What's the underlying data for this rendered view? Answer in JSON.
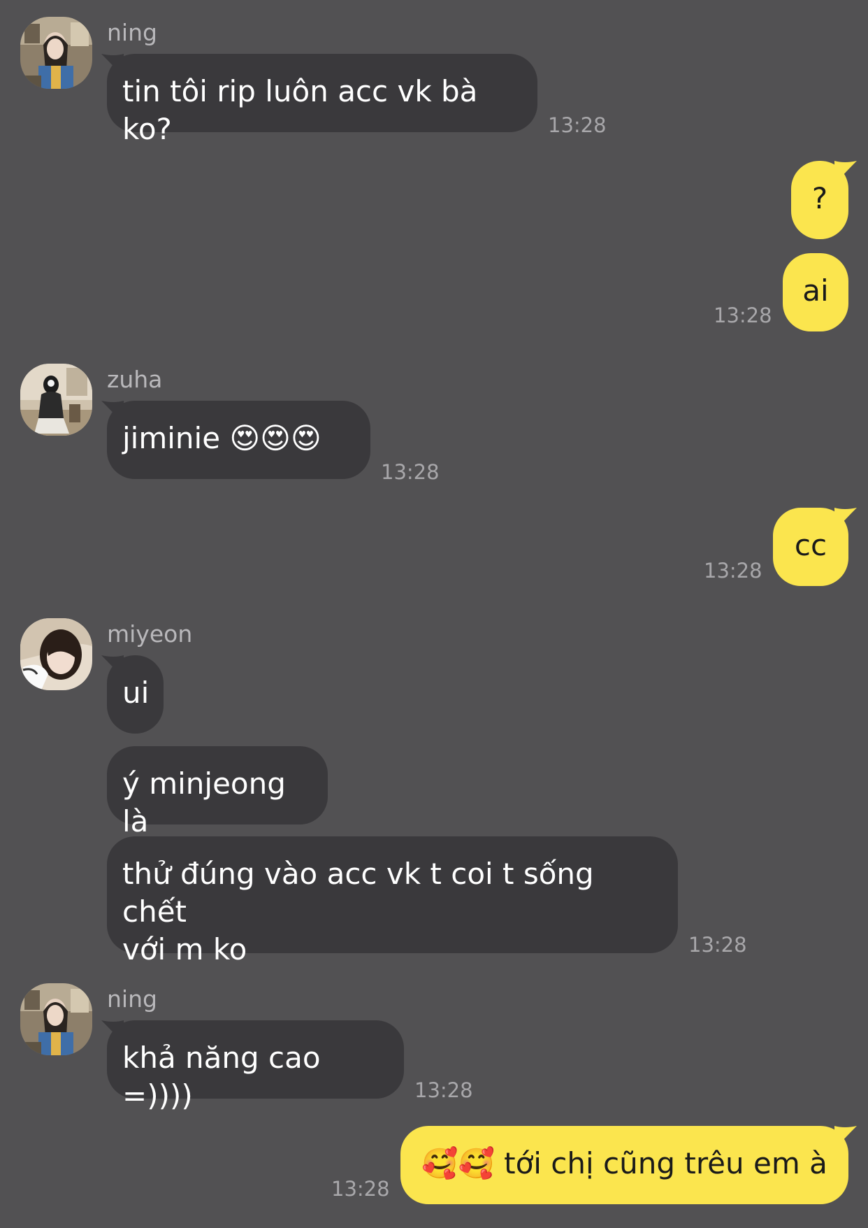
{
  "colors": {
    "background": "#525153",
    "incoming_bubble": "#3a393c",
    "outgoing_bubble": "#fbe54e",
    "meta_text": "#a8a7aa"
  },
  "messages": [
    {
      "sender": "ning",
      "direction": "incoming",
      "text": "tin tôi rip luôn acc vk bà ko?",
      "time": "13:28"
    },
    {
      "direction": "outgoing",
      "text": "?"
    },
    {
      "direction": "outgoing",
      "text": "ai",
      "time": "13:28"
    },
    {
      "sender": "zuha",
      "direction": "incoming",
      "text": "jiminie 😍😍😍",
      "time": "13:28"
    },
    {
      "direction": "outgoing",
      "text": "cc",
      "time": "13:28"
    },
    {
      "sender": "miyeon",
      "direction": "incoming",
      "text": "ui"
    },
    {
      "direction": "incoming",
      "text": "ý minjeong là"
    },
    {
      "direction": "incoming",
      "text": "thử đúng vào acc vk t coi t sống chết\nvới m ko",
      "time": "13:28"
    },
    {
      "sender": "ning",
      "direction": "incoming",
      "text": "khả năng cao =))))",
      "time": "13:28"
    },
    {
      "direction": "outgoing",
      "text": "🥰🥰 tới chị cũng trêu em à",
      "time": "13:28"
    }
  ]
}
